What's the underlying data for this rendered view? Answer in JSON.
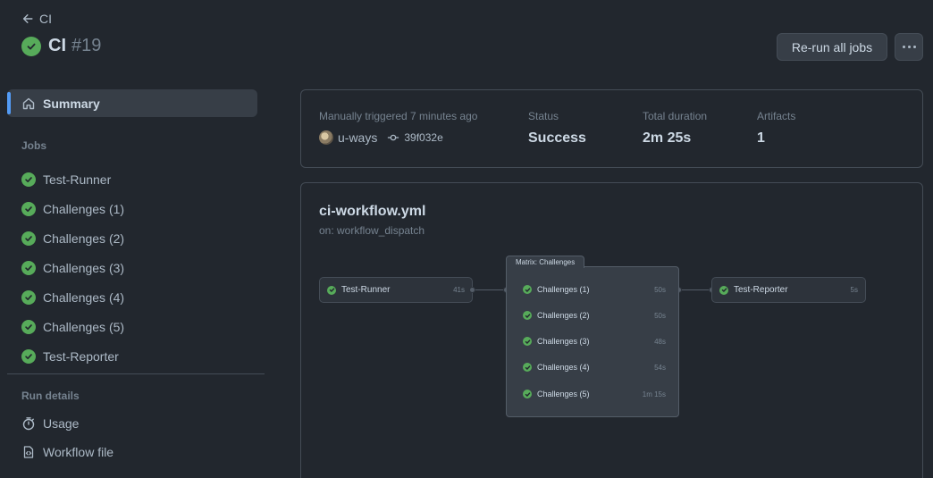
{
  "header": {
    "back_label": "CI",
    "workflow_name": "CI",
    "run_number": "#19",
    "rerun_label": "Re-run all jobs"
  },
  "sidebar": {
    "summary_label": "Summary",
    "jobs_heading": "Jobs",
    "jobs": [
      {
        "label": "Test-Runner"
      },
      {
        "label": "Challenges (1)"
      },
      {
        "label": "Challenges (2)"
      },
      {
        "label": "Challenges (3)"
      },
      {
        "label": "Challenges (4)"
      },
      {
        "label": "Challenges (5)"
      },
      {
        "label": "Test-Reporter"
      }
    ],
    "run_details_heading": "Run details",
    "usage_label": "Usage",
    "workflow_file_label": "Workflow file"
  },
  "summary": {
    "trigger_text": "Manually triggered 7 minutes ago",
    "actor": "u-ways",
    "commit_sha": "39f032e",
    "status_label": "Status",
    "status_value": "Success",
    "duration_label": "Total duration",
    "duration_value": "2m 25s",
    "artifacts_label": "Artifacts",
    "artifacts_value": "1"
  },
  "graph": {
    "file_name": "ci-workflow.yml",
    "trigger": "on: workflow_dispatch",
    "runner": {
      "label": "Test-Runner",
      "duration": "41s"
    },
    "matrix_title": "Matrix: Challenges",
    "matrix_jobs": [
      {
        "label": "Challenges (1)",
        "duration": "50s"
      },
      {
        "label": "Challenges (2)",
        "duration": "50s"
      },
      {
        "label": "Challenges (3)",
        "duration": "48s"
      },
      {
        "label": "Challenges (4)",
        "duration": "54s"
      },
      {
        "label": "Challenges (5)",
        "duration": "1m 15s"
      }
    ],
    "reporter": {
      "label": "Test-Reporter",
      "duration": "5s"
    }
  },
  "colors": {
    "success": "#57ab5a",
    "accent": "#539bf5",
    "background": "#22272e"
  }
}
